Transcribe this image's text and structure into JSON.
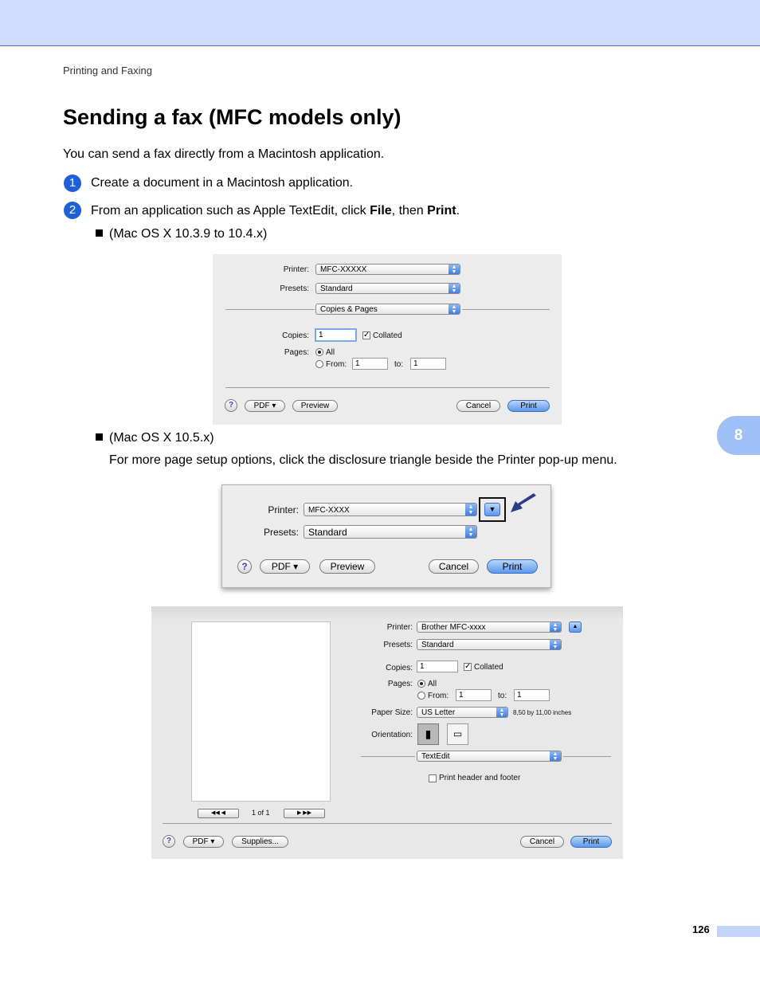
{
  "header": {
    "running_title": "Printing and Faxing"
  },
  "title": "Sending a fax (MFC models only)",
  "intro": "You can send a fax directly from a Macintosh application.",
  "steps": [
    {
      "num": "1",
      "text": "Create a document in a Macintosh application."
    },
    {
      "num": "2",
      "text_pre": "From an application such as Apple TextEdit, click ",
      "bold1": "File",
      "text_mid": ", then ",
      "bold2": "Print",
      "text_post": "."
    }
  ],
  "bullets": {
    "first": "(Mac OS X 10.3.9 to 10.4.x)",
    "second": "(Mac OS X 10.5.x)",
    "second_note": "For more page setup options, click the disclosure triangle beside the Printer pop-up menu."
  },
  "dialog1": {
    "printer_label": "Printer:",
    "printer_value": "MFC-XXXXX",
    "presets_label": "Presets:",
    "presets_value": "Standard",
    "section_value": "Copies & Pages",
    "copies_label": "Copies:",
    "copies_value": "1",
    "collated_label": "Collated",
    "pages_label": "Pages:",
    "all_label": "All",
    "from_label": "From:",
    "from_value": "1",
    "to_label": "to:",
    "to_value": "1",
    "help": "?",
    "pdf": "PDF ▾",
    "preview": "Preview",
    "cancel": "Cancel",
    "print": "Print"
  },
  "dialog2": {
    "printer_label": "Printer:",
    "printer_value": "MFC-XXXX",
    "presets_label": "Presets:",
    "presets_value": "Standard",
    "disclosure": "▼",
    "help": "?",
    "pdf": "PDF ▾",
    "preview": "Preview",
    "cancel": "Cancel",
    "print": "Print"
  },
  "dialog3": {
    "printer_label": "Printer:",
    "printer_value": "Brother MFC-xxxx",
    "presets_label": "Presets:",
    "presets_value": "Standard",
    "copies_label": "Copies:",
    "copies_value": "1",
    "collated_label": "Collated",
    "pages_label": "Pages:",
    "all_label": "All",
    "from_label": "From:",
    "from_value": "1",
    "to_label": "to:",
    "to_value": "1",
    "paper_label": "Paper Size:",
    "paper_value": "US Letter",
    "paper_dims": "8,50 by 11,00 inches",
    "orientation_label": "Orientation:",
    "section_value": "TextEdit",
    "header_footer_label": "Print header and footer",
    "page_count": "1 of 1",
    "help": "?",
    "pdf": "PDF ▾",
    "supplies": "Supplies...",
    "cancel": "Cancel",
    "print": "Print"
  },
  "chapter": "8",
  "page_number": "126",
  "colors": {
    "accent": "#1f5fd8",
    "header_band": "#cdddfb",
    "tab": "#9fbff7"
  }
}
